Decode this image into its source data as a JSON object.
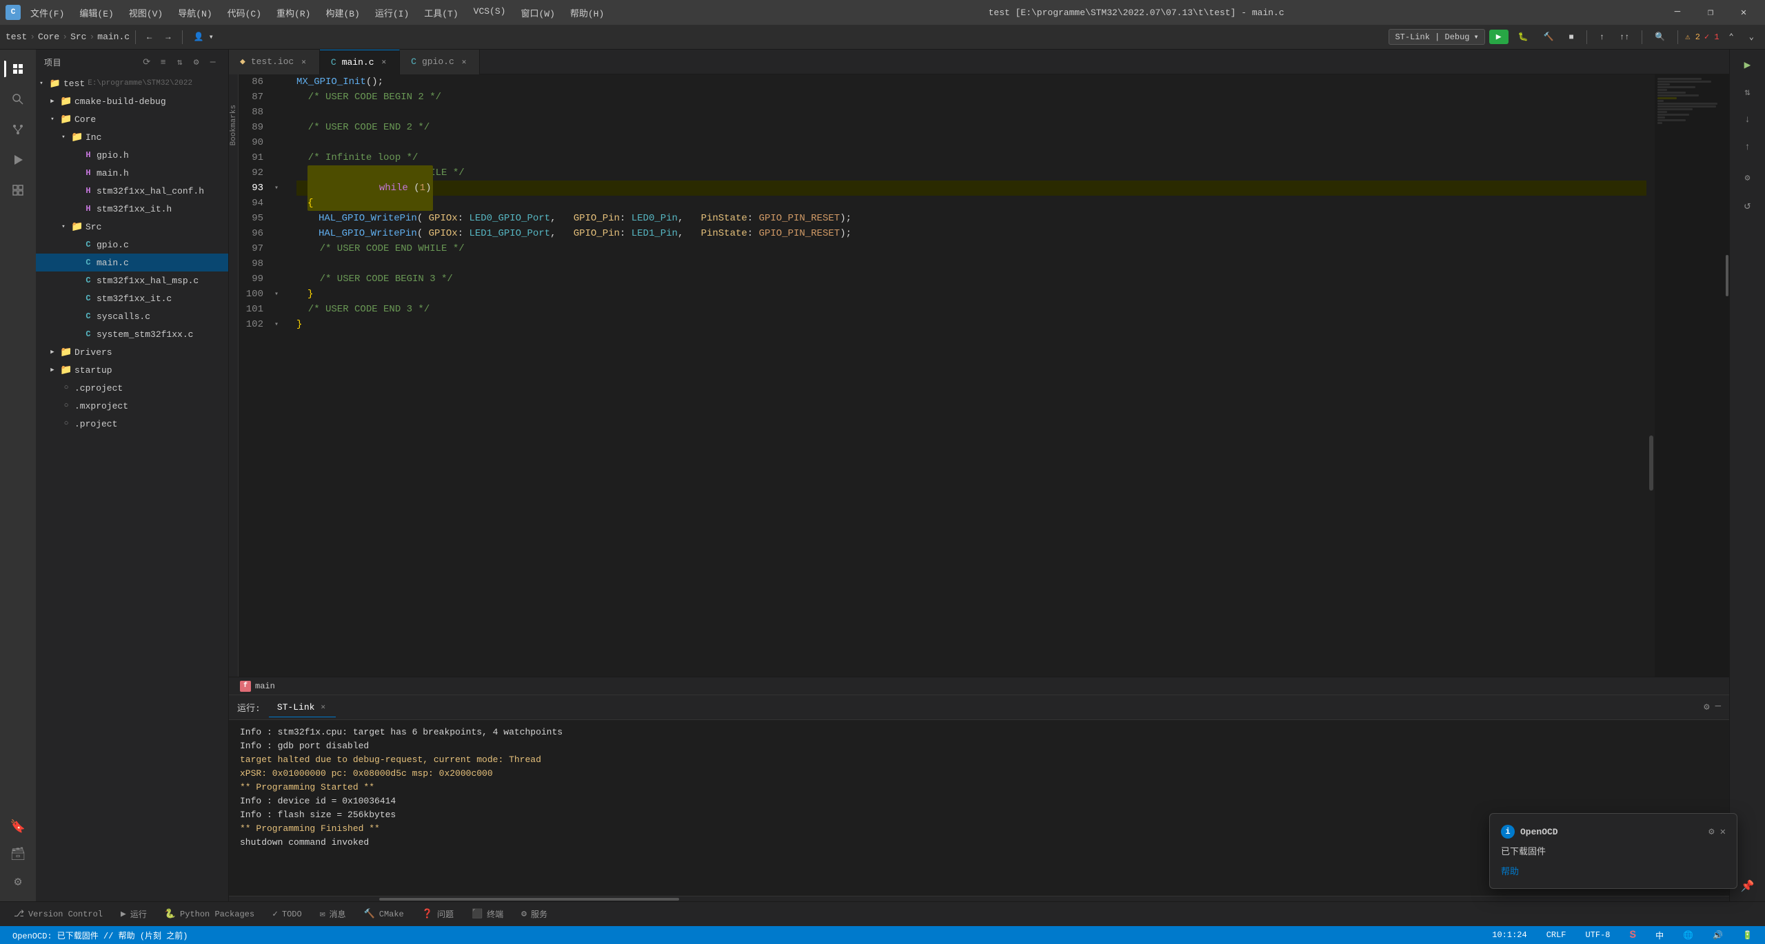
{
  "window": {
    "title": "test [E:\\programme\\STM32\\2022.07\\07.13\\t\\test] - main.c",
    "app_icon": "CLion"
  },
  "menu": {
    "items": [
      "文件(F)",
      "编辑(E)",
      "视图(V)",
      "导航(N)",
      "代码(C)",
      "重构(R)",
      "构建(B)",
      "运行(I)",
      "工具(T)",
      "VCS(S)",
      "窗口(W)",
      "帮助(H)"
    ]
  },
  "breadcrumb": {
    "items": [
      "test",
      "Core",
      "Src",
      "main.c"
    ]
  },
  "toolbar": {
    "debug_config": "ST-Link | Debug",
    "warnings": "2",
    "checks": "1"
  },
  "tabs": [
    {
      "name": "test.ioc",
      "type": "ioc",
      "active": false
    },
    {
      "name": "main.c",
      "type": "c",
      "active": true
    },
    {
      "name": "gpio.c",
      "type": "c",
      "active": false
    }
  ],
  "sidebar": {
    "header": "项目",
    "tree": [
      {
        "level": 0,
        "type": "project",
        "name": "test",
        "suffix": "E:\\programme\\STM32\\2022",
        "expanded": true
      },
      {
        "level": 1,
        "type": "folder",
        "name": "cmake-build-debug",
        "expanded": false
      },
      {
        "level": 1,
        "type": "folder",
        "name": "Core",
        "expanded": true
      },
      {
        "level": 2,
        "type": "folder",
        "name": "Inc",
        "expanded": true
      },
      {
        "level": 3,
        "type": "file-h",
        "name": "gpio.h"
      },
      {
        "level": 3,
        "type": "file-h",
        "name": "main.h"
      },
      {
        "level": 3,
        "type": "file-h",
        "name": "stm32f1xx_hal_conf.h"
      },
      {
        "level": 3,
        "type": "file-h",
        "name": "stm32f1xx_it.h"
      },
      {
        "level": 2,
        "type": "folder",
        "name": "Src",
        "expanded": true
      },
      {
        "level": 3,
        "type": "file-c",
        "name": "gpio.c"
      },
      {
        "level": 3,
        "type": "file-c",
        "name": "main.c",
        "selected": true
      },
      {
        "level": 3,
        "type": "file-c",
        "name": "stm32f1xx_hal_msp.c"
      },
      {
        "level": 3,
        "type": "file-c",
        "name": "stm32f1xx_it.c"
      },
      {
        "level": 3,
        "type": "file-c",
        "name": "syscalls.c"
      },
      {
        "level": 3,
        "type": "file-c",
        "name": "system_stm32f1xx.c"
      },
      {
        "level": 1,
        "type": "folder",
        "name": "Drivers",
        "expanded": false
      },
      {
        "level": 1,
        "type": "folder",
        "name": "startup",
        "expanded": false
      },
      {
        "level": 1,
        "type": "file-other",
        "name": ".cproject"
      },
      {
        "level": 1,
        "type": "file-other",
        "name": ".mxproject"
      },
      {
        "level": 1,
        "type": "file-other",
        "name": ".project"
      }
    ]
  },
  "code": {
    "lines": [
      {
        "num": 86,
        "content": "  MX_GPIO_Init();",
        "indent": "  "
      },
      {
        "num": 87,
        "content": "  /* USER CODE BEGIN 2 */",
        "comment": true
      },
      {
        "num": 88,
        "content": ""
      },
      {
        "num": 89,
        "content": "  /* USER CODE END 2 */",
        "comment": true
      },
      {
        "num": 90,
        "content": ""
      },
      {
        "num": 91,
        "content": "  /* Infinite loop */",
        "comment": true
      },
      {
        "num": 92,
        "content": "  /* USER CODE BEGIN WHILE */",
        "comment": true
      },
      {
        "num": 93,
        "content": "  while (1)",
        "highlight": true,
        "fold": true
      },
      {
        "num": 94,
        "content": "  {"
      },
      {
        "num": 95,
        "content": "    HAL_GPIO_WritePin( GPIOx: LED0_GPIO_Port,   GPIO_Pin: LED0_Pin,   PinState: GPIO_PIN_RESET);"
      },
      {
        "num": 96,
        "content": "    HAL_GPIO_WritePin( GPIOx: LED1_GPIO_Port,   GPIO_Pin: LED1_Pin,   PinState: GPIO_PIN_RESET);"
      },
      {
        "num": 97,
        "content": "    /* USER CODE END WHILE */",
        "comment": true
      },
      {
        "num": 98,
        "content": ""
      },
      {
        "num": 99,
        "content": "    /* USER CODE BEGIN 3 */",
        "comment": true
      },
      {
        "num": 100,
        "content": "  }",
        "fold": true
      },
      {
        "num": 101,
        "content": "  /* USER CODE END 3 */",
        "comment": true
      },
      {
        "num": 102,
        "content": "}",
        "fold": true
      }
    ],
    "fn_name": "main"
  },
  "terminal": {
    "tab_label": "ST-Link",
    "running_label": "运行:",
    "messages": [
      {
        "type": "normal",
        "text": "Info : stm32f1x.cpu: target has 6 breakpoints, 4 watchpoints"
      },
      {
        "type": "normal",
        "text": "Info : gdb port disabled"
      },
      {
        "type": "yellow",
        "text": "target halted due to debug-request, current mode: Thread"
      },
      {
        "type": "yellow",
        "text": "xPSR: 0x01000000 pc: 0x08000d5c msp: 0x2000c000"
      },
      {
        "type": "yellow",
        "text": "** Programming Started **"
      },
      {
        "type": "normal",
        "text": "Info : device id = 0x10036414"
      },
      {
        "type": "normal",
        "text": "Info : flash size = 256kbytes"
      },
      {
        "type": "yellow",
        "text": "** Programming Finished **"
      },
      {
        "type": "normal",
        "text": "shutdown command invoked"
      }
    ]
  },
  "notification": {
    "icon": "i",
    "title": "OpenOCD",
    "body": "已下载固件",
    "link": "帮助",
    "gear_icon": "⚙",
    "close_icon": "✕"
  },
  "bottom_tabs": [
    {
      "icon": "⎇",
      "label": "Version Control"
    },
    {
      "icon": "▶",
      "label": "运行"
    },
    {
      "icon": "📦",
      "label": "Python Packages"
    },
    {
      "icon": "✓",
      "label": "TODO"
    },
    {
      "icon": "✉",
      "label": "消息"
    },
    {
      "icon": "🔨",
      "label": "CMake"
    },
    {
      "icon": "❓",
      "label": "问题"
    },
    {
      "icon": "⬛",
      "label": "终端"
    },
    {
      "icon": "⚙",
      "label": "服务"
    }
  ],
  "status_bar": {
    "left_text": "OpenOCD: 已下载固件 // 帮助 (片刻 之前)",
    "time": "10:1:24",
    "encoding": "CRLF",
    "charset": "UTF-8"
  },
  "run_sidebar": {
    "run_icon": "▶",
    "step_over": "↷",
    "step_into": "↓",
    "step_out": "↑",
    "stop": "■",
    "resume": "▶",
    "restart": "↺"
  }
}
